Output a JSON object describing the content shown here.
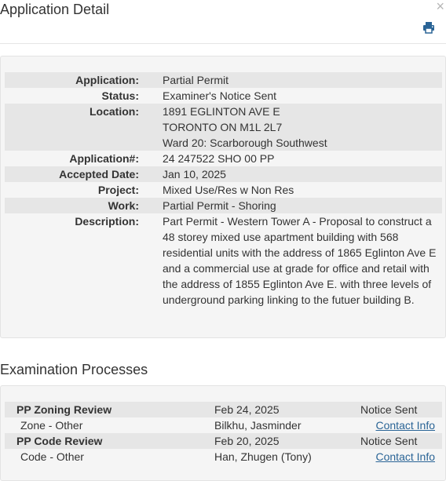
{
  "modal": {
    "title": "Application Detail",
    "close_label": "×",
    "print_icon": "print-icon"
  },
  "detail": {
    "rows": [
      {
        "label": "Application:",
        "value": "Partial Permit"
      },
      {
        "label": "Status:",
        "value": "Examiner's Notice Sent"
      },
      {
        "label": "Location:",
        "lines": [
          "1891 EGLINTON AVE E",
          "TORONTO ON M1L 2L7",
          "Ward 20: Scarborough Southwest"
        ]
      },
      {
        "label": "Application#:",
        "value": "24 247522 SHO 00 PP"
      },
      {
        "label": "Accepted Date:",
        "value": "Jan 10, 2025"
      },
      {
        "label": "Project:",
        "value": "Mixed Use/Res w Non Res"
      },
      {
        "label": "Work:",
        "value": "Partial Permit - Shoring"
      },
      {
        "label": "Description:",
        "value": "Part Permit - Western Tower A - Proposal to construct a 48 storey mixed use apartment building with 568 residential units with the address of 1865 Eglinton Ave E and a commercial use at grade for office and retail with the address of 1855 Eglinton Ave E. with three levels of underground parking linking to the futuer building B."
      }
    ]
  },
  "exam": {
    "title": "Examination Processes",
    "rows": [
      {
        "name": "PP Zoning Review",
        "date": "Feb 24, 2025",
        "status": "Notice Sent"
      },
      {
        "name": "Zone - Other",
        "person": "Bilkhu, Jasminder",
        "link": "Contact Info"
      },
      {
        "name": "PP Code Review",
        "date": "Feb 20, 2025",
        "status": "Notice Sent"
      },
      {
        "name": "Code - Other",
        "person": "Han, Zhugen (Tony)",
        "link": "Contact Info"
      }
    ]
  }
}
